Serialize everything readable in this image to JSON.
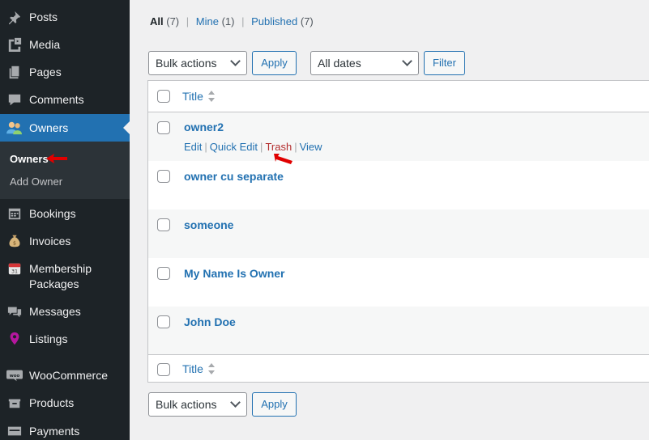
{
  "sidebar": {
    "items": [
      {
        "label": "Posts",
        "icon": "pin-icon"
      },
      {
        "label": "Media",
        "icon": "media-icon"
      },
      {
        "label": "Pages",
        "icon": "pages-icon"
      },
      {
        "label": "Comments",
        "icon": "comment-icon"
      },
      {
        "label": "Owners",
        "icon": "users-icon"
      },
      {
        "label": "Bookings",
        "icon": "calendar-icon"
      },
      {
        "label": "Invoices",
        "icon": "money-bag-icon"
      },
      {
        "label": "Membership Packages",
        "label_line1": "Membership",
        "label_line2": "Packages",
        "icon": "calendar-31-icon"
      },
      {
        "label": "Messages",
        "icon": "messages-icon"
      },
      {
        "label": "Listings",
        "icon": "location-pin-icon"
      },
      {
        "label": "WooCommerce",
        "icon": "woo-icon"
      },
      {
        "label": "Products",
        "icon": "products-icon"
      },
      {
        "label": "Payments",
        "icon": "payments-icon"
      }
    ],
    "submenu": [
      "Owners",
      "Add Owner"
    ],
    "active_color": "#2271b1"
  },
  "filters": {
    "all": "All",
    "all_count": "(7)",
    "mine": "Mine",
    "mine_count": "(1)",
    "published": "Published",
    "published_count": "(7)",
    "sep": "|"
  },
  "toolbar": {
    "bulk_actions": "Bulk actions",
    "apply": "Apply",
    "all_dates": "All dates",
    "filter": "Filter"
  },
  "table": {
    "column_title": "Title",
    "rows": [
      {
        "title": "owner2"
      },
      {
        "title": "owner cu separate"
      },
      {
        "title": "someone"
      },
      {
        "title": "My Name Is Owner"
      },
      {
        "title": "John Doe"
      }
    ],
    "row_actions": {
      "edit": "Edit",
      "quick_edit": "Quick Edit",
      "trash": "Trash",
      "view": "View",
      "sep": "|"
    }
  },
  "colors": {
    "link": "#2271b1",
    "trash": "#b32d2e",
    "annotation": "#e00000",
    "sidebar_bg": "#1d2327"
  }
}
